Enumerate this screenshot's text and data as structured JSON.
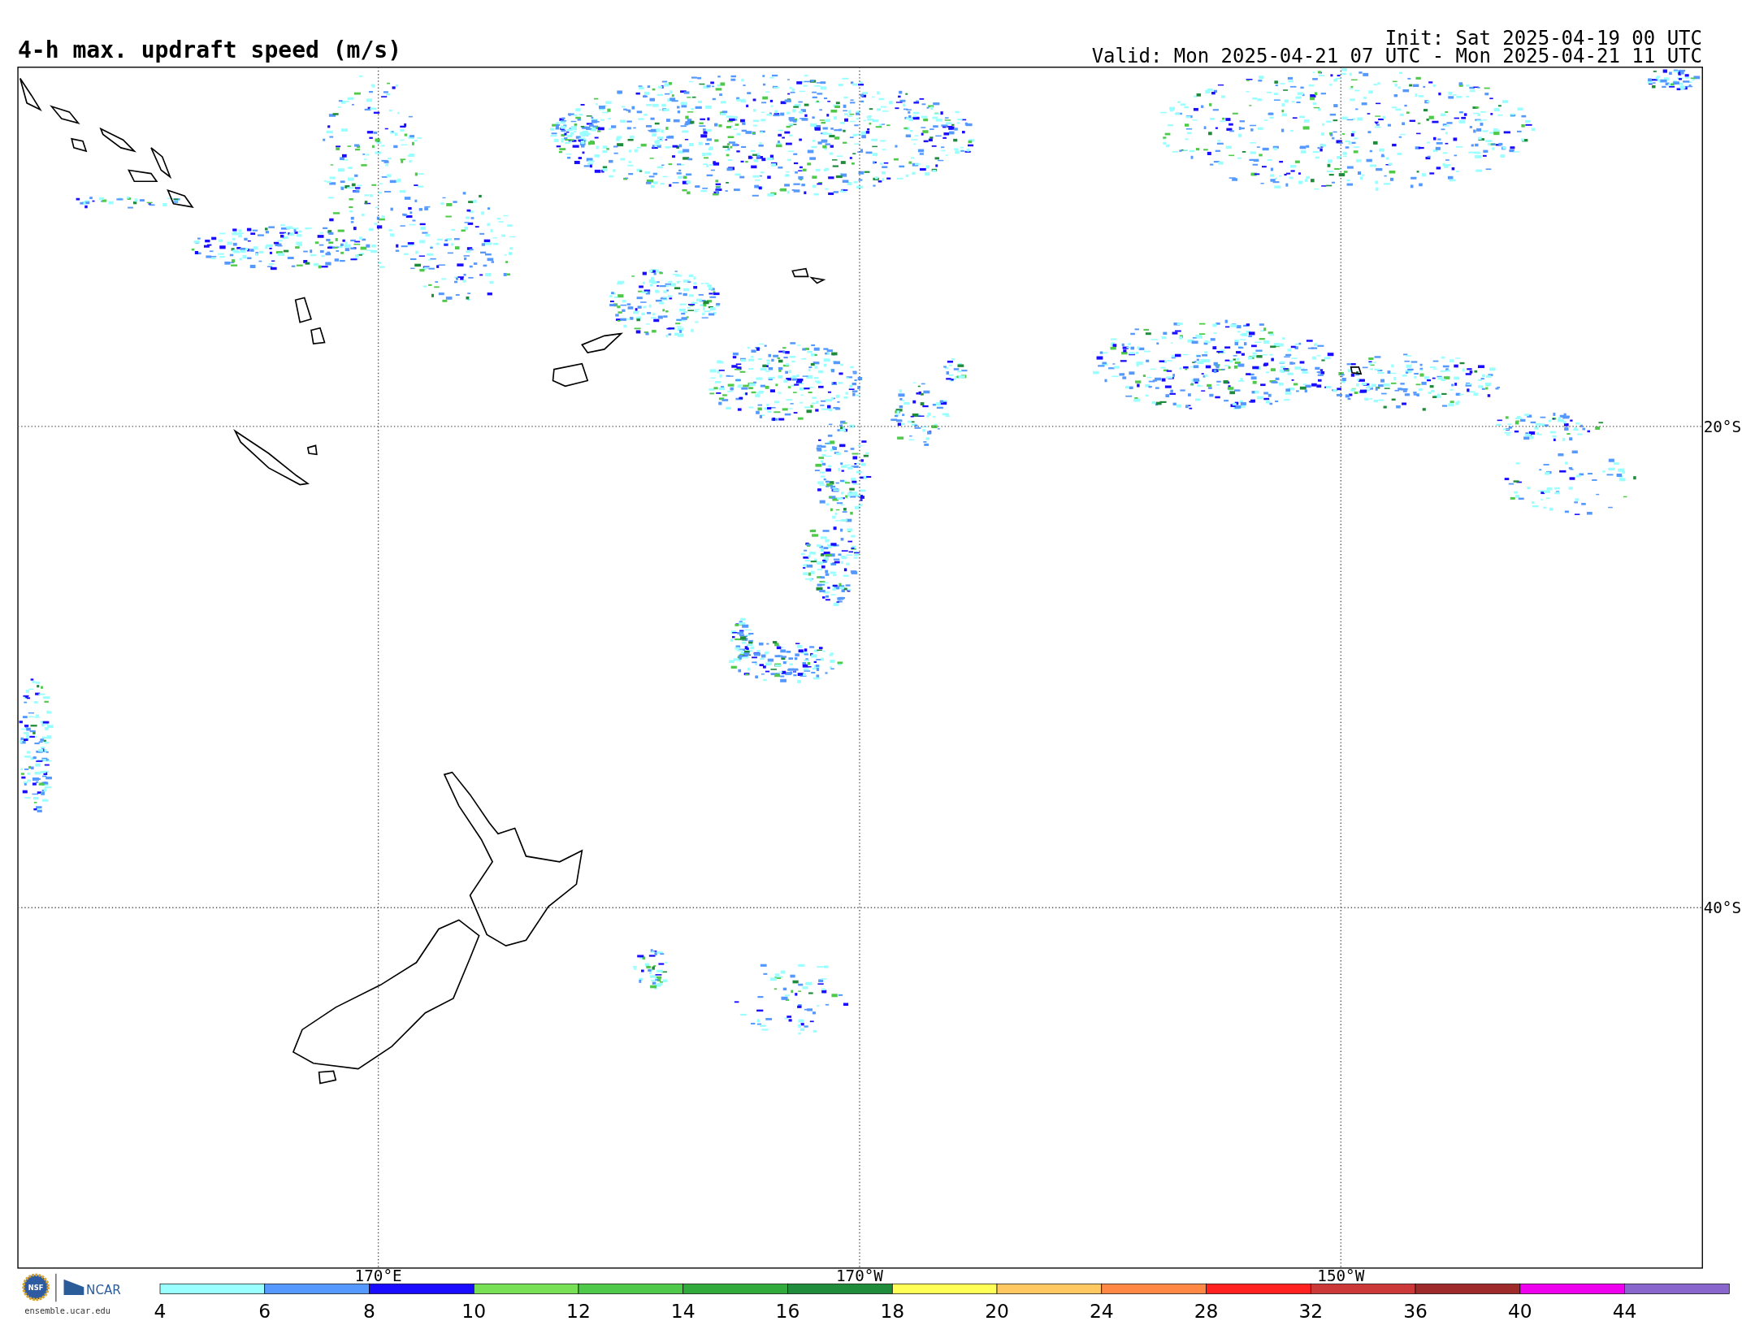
{
  "title": "4-h max. updraft speed (m/s)",
  "init": "Init: Sat 2025-04-19 00 UTC",
  "valid": "Valid: Mon 2025-04-21 07 UTC - Mon 2025-04-21 11 UTC",
  "map": {
    "lat_labels": [
      "20°S",
      "40°S"
    ],
    "lon_labels": [
      "170°E",
      "170°W",
      "150°W"
    ]
  },
  "colorbar": {
    "segments": [
      {
        "label": "4",
        "color": "#99ffff"
      },
      {
        "label": "6",
        "color": "#5599ff"
      },
      {
        "label": "8",
        "color": "#1a0dff"
      },
      {
        "label": "10",
        "color": "#77e055"
      },
      {
        "label": "12",
        "color": "#4fc94a"
      },
      {
        "label": "14",
        "color": "#30aa3a"
      },
      {
        "label": "16",
        "color": "#1e8c3a"
      },
      {
        "label": "18",
        "color": "#ffff55"
      },
      {
        "label": "20",
        "color": "#ffc860"
      },
      {
        "label": "24",
        "color": "#ff8844"
      },
      {
        "label": "28",
        "color": "#ff2020"
      },
      {
        "label": "32",
        "color": "#cc3838"
      },
      {
        "label": "36",
        "color": "#9e2a2a"
      },
      {
        "label": "40",
        "color": "#ee00ee"
      },
      {
        "label": "44",
        "color": "#8866cc"
      }
    ]
  },
  "footer": {
    "nsf_logo": "NSF",
    "ncar_logo": "NCAR",
    "url": "ensemble.ucar.edu"
  }
}
